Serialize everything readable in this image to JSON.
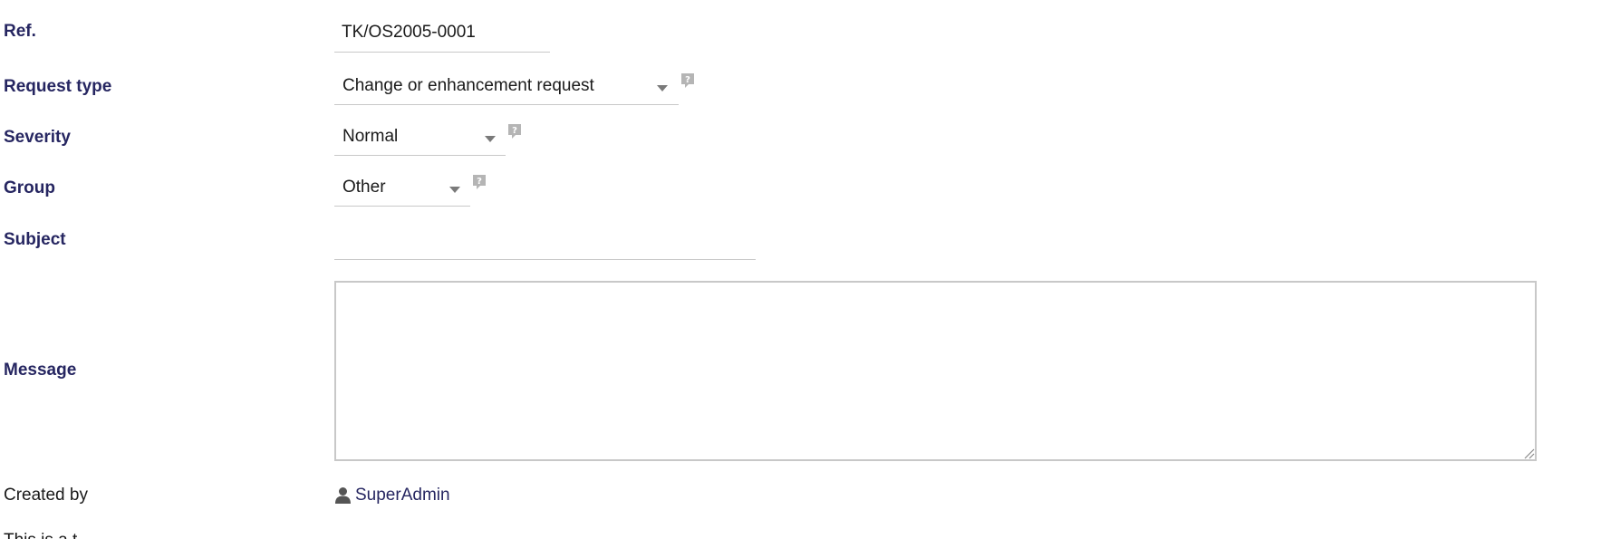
{
  "form": {
    "ref": {
      "label": "Ref.",
      "value": "TK/OS2005-0001"
    },
    "request_type": {
      "label": "Request type",
      "selected": "Change or enhancement request",
      "help_icon": "help-question-icon"
    },
    "severity": {
      "label": "Severity",
      "selected": "Normal",
      "help_icon": "help-question-icon"
    },
    "group": {
      "label": "Group",
      "selected": "Other",
      "help_icon": "help-question-icon"
    },
    "subject": {
      "label": "Subject",
      "value": ""
    },
    "message": {
      "label": "Message",
      "value": ""
    },
    "created_by": {
      "label": "Created by",
      "user": "SuperAdmin",
      "user_icon": "user-icon"
    },
    "next_row_partial": {
      "label": "This is a t"
    }
  },
  "colors": {
    "label_bold": "#262661",
    "link": "#262661",
    "border": "#c8c8c8",
    "caret": "#7a7a7a",
    "help_icon_bg": "#b5b5b5"
  }
}
